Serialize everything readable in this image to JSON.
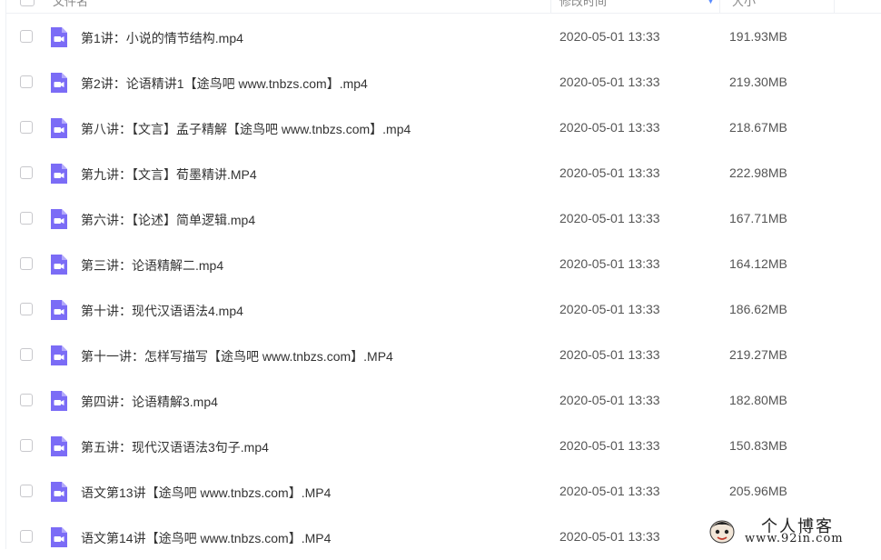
{
  "header": {
    "col_name": "文件名",
    "col_time": "修改时间",
    "col_size": "大小"
  },
  "files": [
    {
      "name": "第1讲：小说的情节结构.mp4",
      "time": "2020-05-01 13:33",
      "size": "191.93MB"
    },
    {
      "name": "第2讲：论语精讲1【途鸟吧 www.tnbzs.com】.mp4",
      "time": "2020-05-01 13:33",
      "size": "219.30MB"
    },
    {
      "name": "第八讲：【文言】孟子精解【途鸟吧 www.tnbzs.com】.mp4",
      "time": "2020-05-01 13:33",
      "size": "218.67MB"
    },
    {
      "name": "第九讲：【文言】荀墨精讲.MP4",
      "time": "2020-05-01 13:33",
      "size": "222.98MB"
    },
    {
      "name": "第六讲：【论述】简单逻辑.mp4",
      "time": "2020-05-01 13:33",
      "size": "167.71MB"
    },
    {
      "name": "第三讲：论语精解二.mp4",
      "time": "2020-05-01 13:33",
      "size": "164.12MB"
    },
    {
      "name": "第十讲：现代汉语语法4.mp4",
      "time": "2020-05-01 13:33",
      "size": "186.62MB"
    },
    {
      "name": "第十一讲：怎样写描写【途鸟吧 www.tnbzs.com】.MP4",
      "time": "2020-05-01 13:33",
      "size": "219.27MB"
    },
    {
      "name": "第四讲：论语精解3.mp4",
      "time": "2020-05-01 13:33",
      "size": "182.80MB"
    },
    {
      "name": "第五讲：现代汉语语法3句子.mp4",
      "time": "2020-05-01 13:33",
      "size": "150.83MB"
    },
    {
      "name": "语文第13讲【途鸟吧 www.tnbzs.com】.MP4",
      "time": "2020-05-01 13:33",
      "size": "205.96MB"
    },
    {
      "name": "语文第14讲【途鸟吧 www.tnbzs.com】.MP4",
      "time": "2020-05-01 13:33",
      "size": ""
    }
  ],
  "icons": {
    "file_icon": "video-file-icon",
    "checkbox": "checkbox-icon"
  },
  "colors": {
    "accent": "#7b6cf6",
    "text": "#333333",
    "meta_text": "#555555"
  },
  "watermark": {
    "title": "个人博客",
    "url": "www.92in.com"
  }
}
